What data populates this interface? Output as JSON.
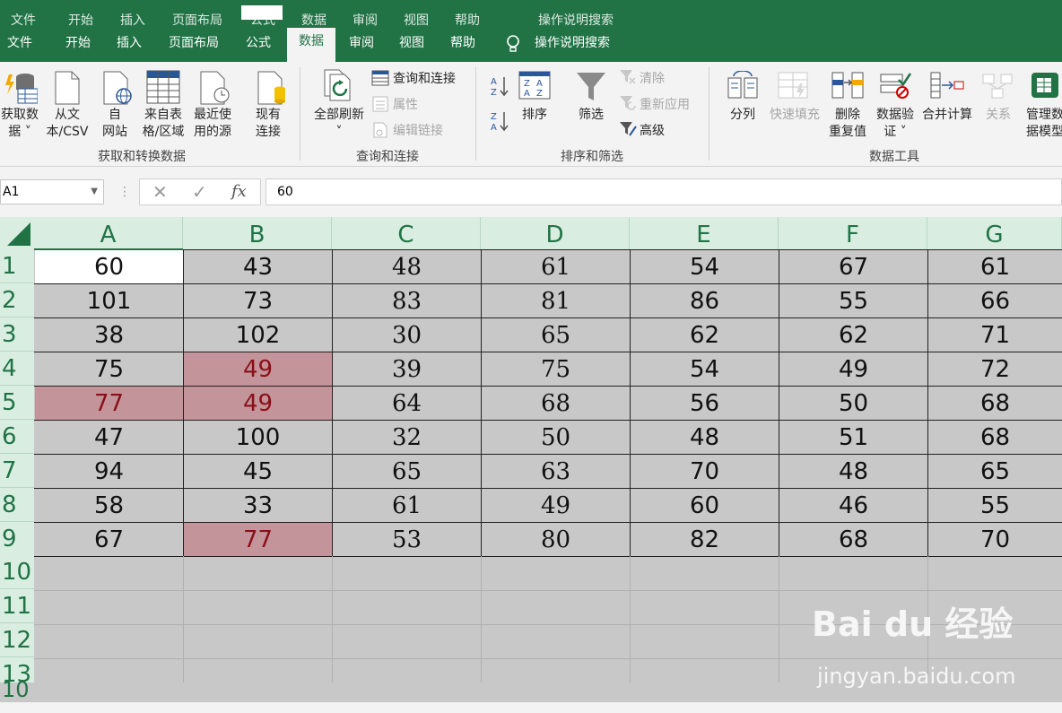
{
  "ghost_tabs": [
    "文件",
    "开始",
    "插入",
    "页面布局",
    "公式",
    "数据",
    "审阅",
    "视图",
    "帮助",
    "操作说明搜索"
  ],
  "tabs": [
    "文件",
    "开始",
    "插入",
    "页面布局",
    "公式",
    "数据",
    "审阅",
    "视图",
    "帮助"
  ],
  "active_tab": "数据",
  "tell_me": "操作说明搜索",
  "ribbon": {
    "get_data": "获取数据",
    "get_data_2": "据",
    "get_data_prefix": "获取数",
    "from_csv_1": "从文",
    "from_csv_2": "本/CSV",
    "from_web_1": "自",
    "from_web_2": "网站",
    "from_table_1": "来自表",
    "from_table_2": "格/区域",
    "recent_1": "最近使",
    "recent_2": "用的源",
    "existing_1": "现有",
    "existing_2": "连接",
    "group_get": "获取和转换数据",
    "refresh_all": "全部刷新",
    "queries": "查询和连接",
    "properties": "属性",
    "edit_links": "编辑链接",
    "group_queries": "查询和连接",
    "sort": "排序",
    "filter": "筛选",
    "clear": "清除",
    "reapply": "重新应用",
    "advanced": "高级",
    "group_sort": "排序和筛选",
    "text_to_col": "分列",
    "flash_fill": "快速填充",
    "remove_dup_1": "删除",
    "remove_dup_2": "重复值",
    "validation_1": "数据验",
    "validation_2": "证",
    "consolidate": "合并计算",
    "relations": "关系",
    "model_1": "管理数",
    "model_2": "据模型",
    "group_tools": "数据工具"
  },
  "formula_bar": {
    "name_box": "A1",
    "fx": "fx",
    "value": "60"
  },
  "columns": [
    "A",
    "B",
    "C",
    "D",
    "E",
    "F",
    "G"
  ],
  "rows": [
    "1",
    "2",
    "3",
    "4",
    "5",
    "6",
    "7",
    "8",
    "9",
    "10",
    "11",
    "12",
    "13"
  ],
  "bottom_row_label": "10",
  "cells": [
    [
      "60",
      "43",
      "48",
      "61",
      "54",
      "67",
      "61"
    ],
    [
      "101",
      "73",
      "83",
      "81",
      "86",
      "55",
      "66"
    ],
    [
      "38",
      "102",
      "30",
      "65",
      "62",
      "62",
      "71"
    ],
    [
      "75",
      "49",
      "39",
      "75",
      "54",
      "49",
      "72"
    ],
    [
      "77",
      "49",
      "64",
      "68",
      "56",
      "50",
      "68"
    ],
    [
      "47",
      "100",
      "32",
      "50",
      "48",
      "51",
      "68"
    ],
    [
      "94",
      "45",
      "65",
      "63",
      "70",
      "48",
      "65"
    ],
    [
      "58",
      "33",
      "61",
      "49",
      "60",
      "46",
      "55"
    ],
    [
      "67",
      "77",
      "53",
      "80",
      "82",
      "68",
      "70"
    ]
  ],
  "highlighted_cells": [
    [
      "3",
      "1"
    ],
    [
      "4",
      "0"
    ],
    [
      "4",
      "1"
    ],
    [
      "8",
      "1"
    ]
  ],
  "colors": {
    "accent": "#217346",
    "highlight": "#c4949b",
    "highlight_text": "#8b0f18",
    "cell_bg": "#c8c8c8"
  },
  "watermark": {
    "brand": "Bai du 经验",
    "url": "jingyan.baidu.com"
  }
}
